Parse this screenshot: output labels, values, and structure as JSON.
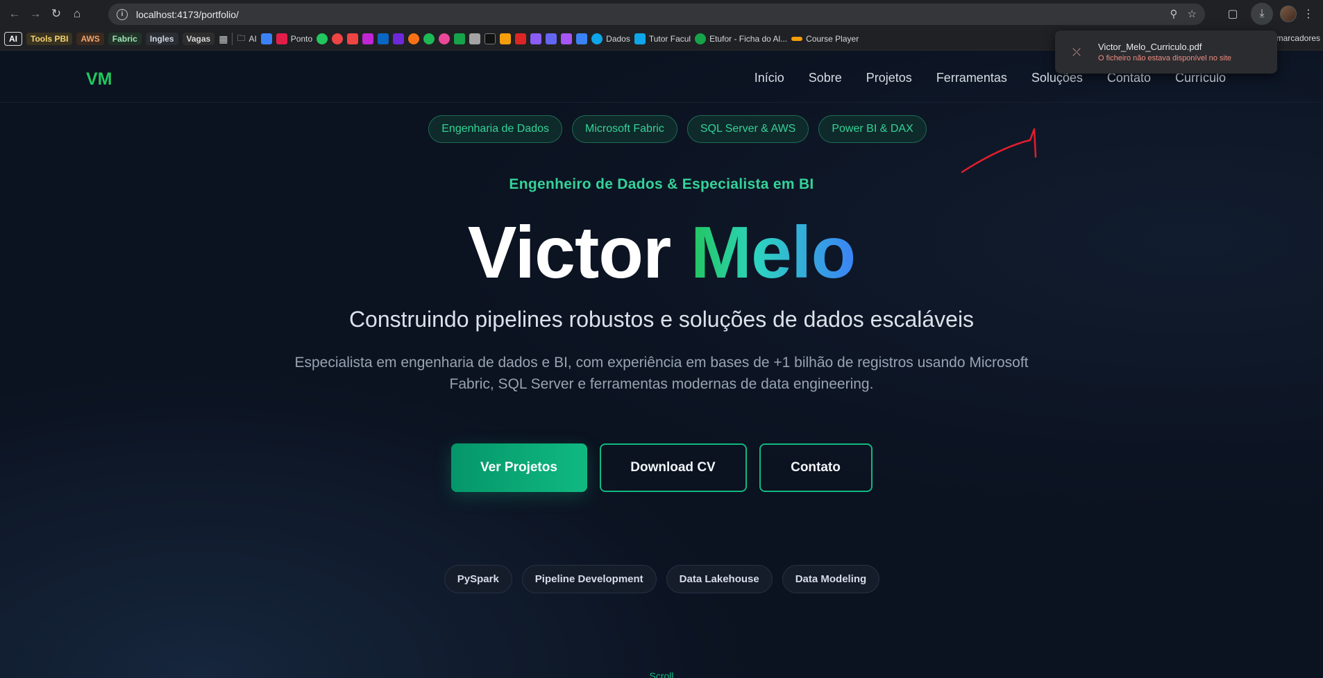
{
  "browser": {
    "url": "localhost:4173/portfolio/",
    "bookmarks": {
      "chips": [
        "AI",
        "Tools PBI",
        "AWS",
        "Fabric",
        "Ingles",
        "Vagas"
      ],
      "folder": "AI",
      "links": [
        "Ponto",
        "Dados",
        "Tutor Facul",
        "Etufor - Ficha do Al...",
        "Course Player"
      ],
      "more": "marcadores"
    },
    "download": {
      "filename": "Victor_Melo_Curriculo.pdf",
      "status": "O ficheiro não estava disponível no site"
    }
  },
  "site": {
    "logo": "VM",
    "nav": [
      "Início",
      "Sobre",
      "Projetos",
      "Ferramentas",
      "Soluções",
      "Contato",
      "Currículo"
    ],
    "tags": [
      "Engenharia de Dados",
      "Microsoft Fabric",
      "SQL Server & AWS",
      "Power BI & DAX"
    ],
    "eyebrow": "Engenheiro de Dados & Especialista em BI",
    "name_first": "Victor",
    "name_last": "Melo",
    "subtitle": "Construindo pipelines robustos e soluções de dados escaláveis",
    "description": "Especialista em engenharia de dados e BI, com experiência em bases de +1 bilhão de registros usando Microsoft Fabric, SQL Server e ferramentas modernas de data engineering.",
    "cta": {
      "primary": "Ver Projetos",
      "cv": "Download CV",
      "contact": "Contato"
    },
    "skills": [
      "PySpark",
      "Pipeline Development",
      "Data Lakehouse",
      "Data Modeling"
    ],
    "scroll": "Scroll"
  },
  "colors": {
    "accent": "#10b981",
    "accent_green": "#22c55e",
    "gradient_end": "#3b82f6",
    "background": "#0b1220",
    "error": "#f28b82"
  }
}
